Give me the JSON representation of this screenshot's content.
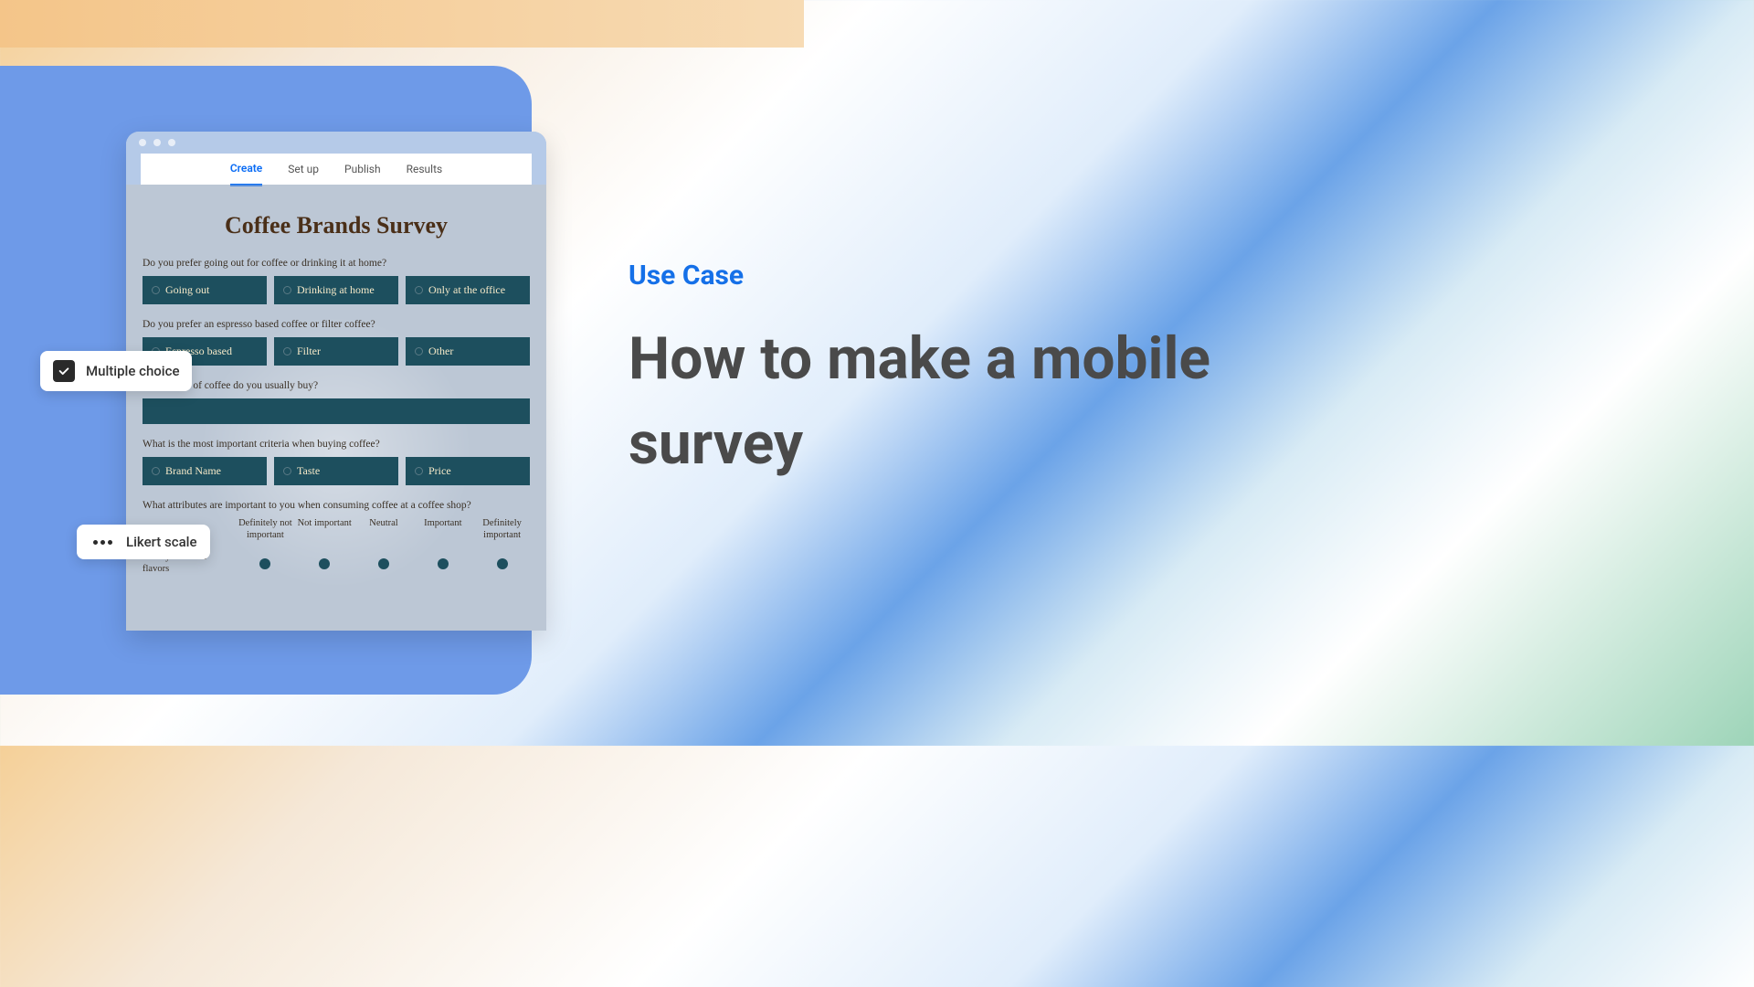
{
  "tabs": [
    "Create",
    "Set up",
    "Publish",
    "Results"
  ],
  "survey": {
    "title": "Coffee Brands Survey",
    "q1": {
      "text": "Do you prefer going out for coffee or drinking it at home?",
      "options": [
        "Going out",
        "Drinking at home",
        "Only at the office"
      ]
    },
    "q2": {
      "text": "Do you prefer an espresso based coffee or filter coffee?",
      "options": [
        "Espresso based",
        "Filter",
        "Other"
      ]
    },
    "q3": {
      "text": "s of coffee do you usually buy?"
    },
    "q4": {
      "text": "What is the most important criteria when buying coffee?",
      "options": [
        "Brand Name",
        "Taste",
        "Price"
      ]
    },
    "q5": {
      "text": "What attributes are important to you when consuming coffee at a coffee shop?",
      "scale": [
        "Definitely not important",
        "Not important",
        "Neutral",
        "Important",
        "Definitely important"
      ],
      "row1": "Variety of coffee flavors"
    }
  },
  "tags": {
    "mc": "Multiple choice",
    "likert": "Likert scale"
  },
  "content": {
    "eyebrow": "Use Case",
    "headline": "How to make a mobile survey"
  }
}
